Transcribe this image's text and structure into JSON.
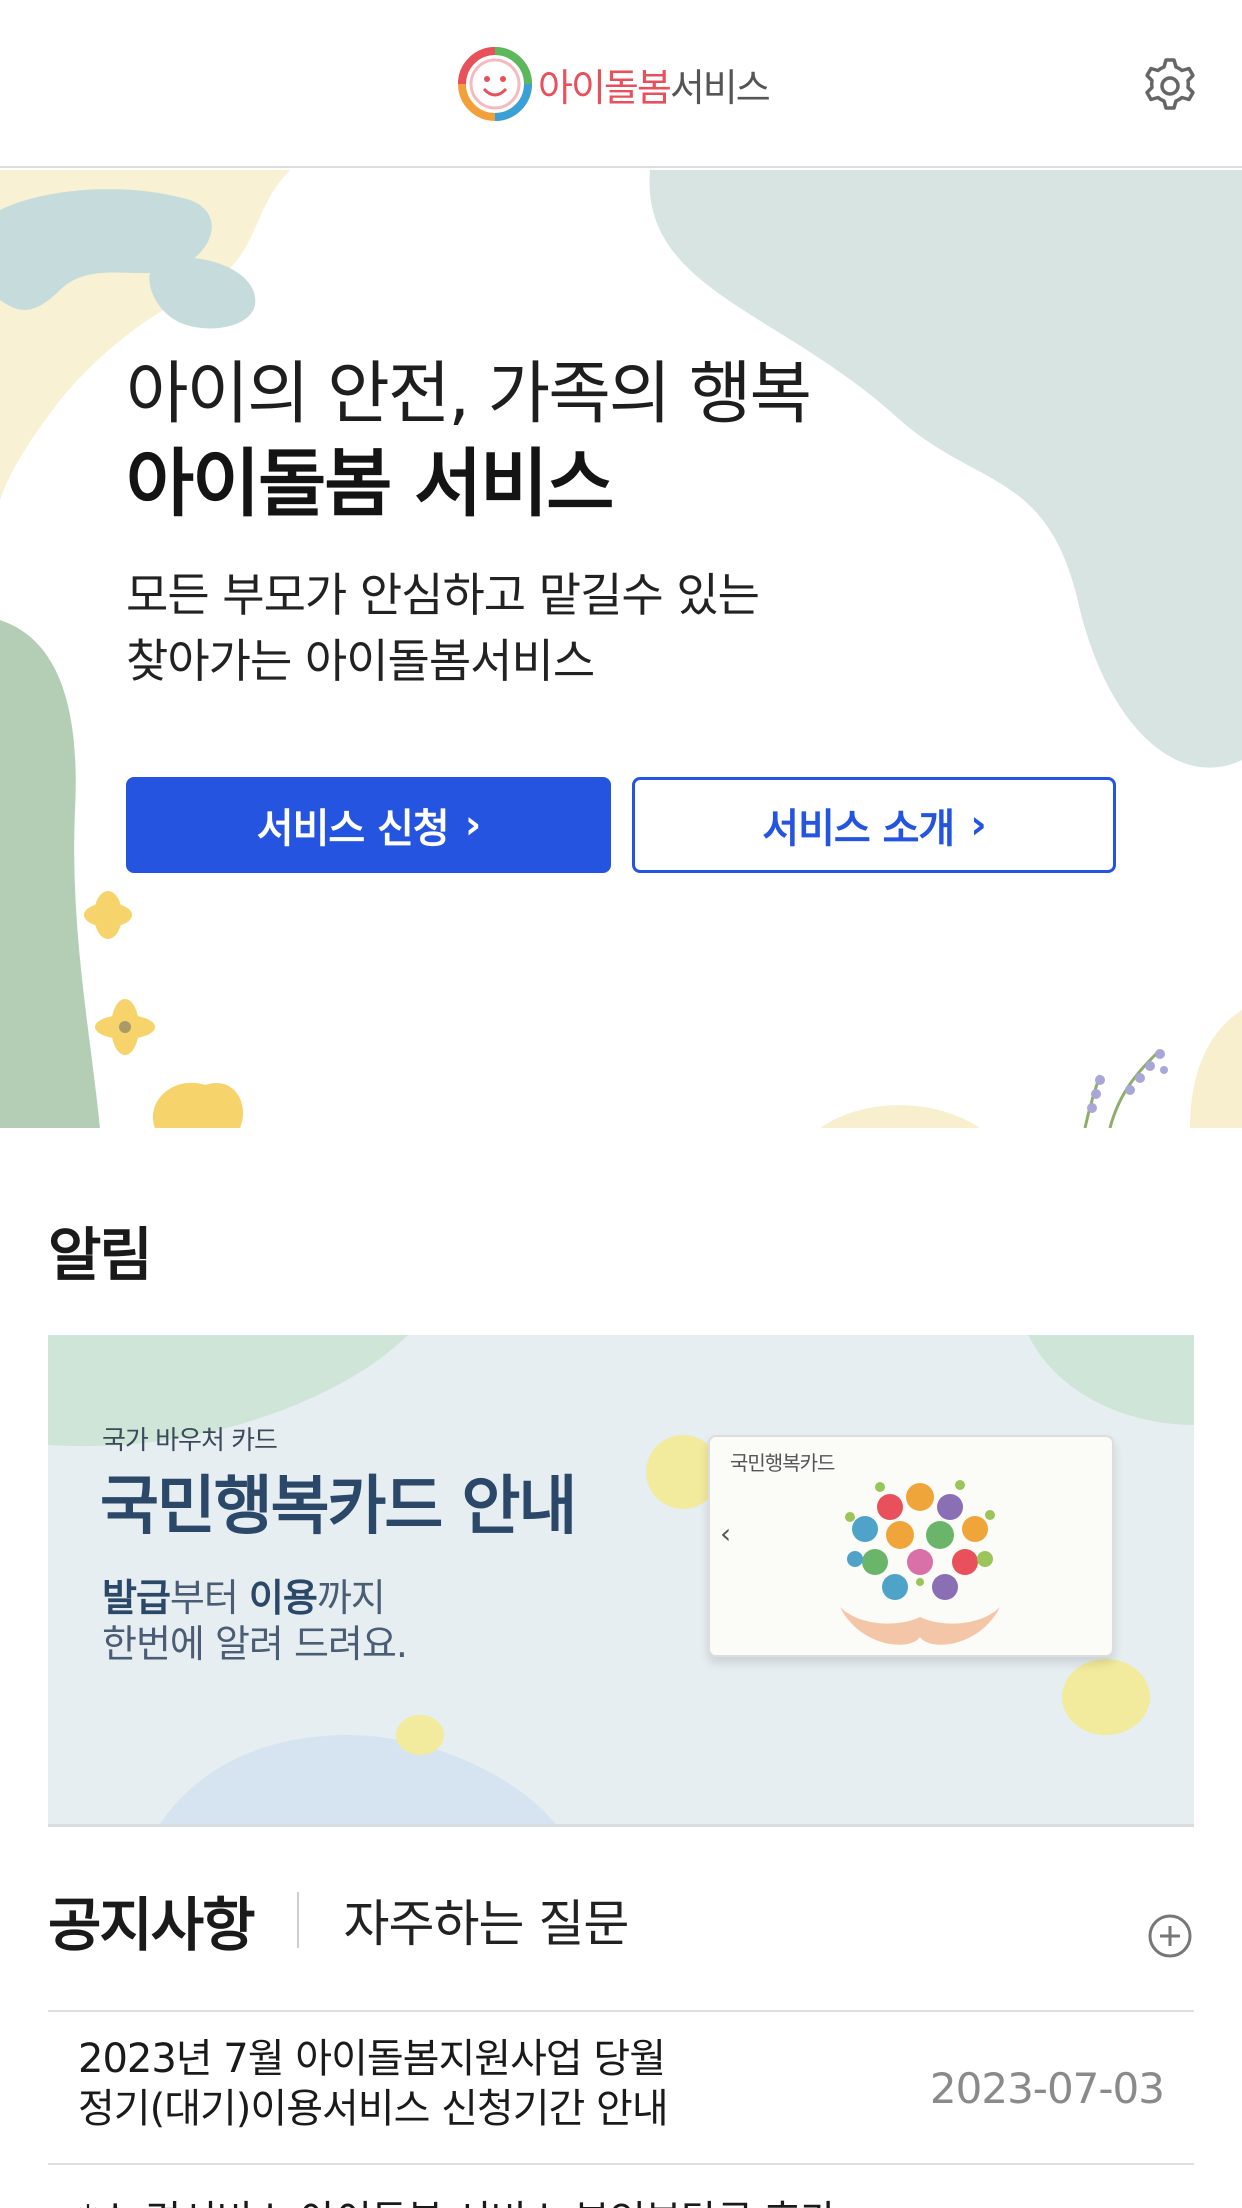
{
  "header": {
    "brand_text": "아이돌봄",
    "brand_suffix": "서비스"
  },
  "hero": {
    "title": "아이의 안전, 가족의 행복",
    "title_strong": "아이돌봄 서비스",
    "subtitle_line1": "모든 부모가 안심하고 맡길수 있는",
    "subtitle_line2": "찾아가는 아이돌봄서비스",
    "apply_button": "서비스 신청",
    "intro_button": "서비스 소개",
    "chevron": "›"
  },
  "notice_section": {
    "title": "알림"
  },
  "banner": {
    "eyebrow": "국가 바우처 카드",
    "title": "국민행복카드 안내",
    "desc_line1_strong1": "발급",
    "desc_line1_mid": "부터 ",
    "desc_line1_strong2": "이용",
    "desc_line1_end": "까지",
    "desc_line2": "한번에 알려 드려요.",
    "card_label": "국민행복카드",
    "card_arrow": "‹"
  },
  "tabs": {
    "active": "공지사항",
    "inactive": "자주하는 질문"
  },
  "notices": [
    {
      "title_line1": "2023년 7월 아이돌봄지원사업 당월",
      "title_line2": "정기(대기)이용서비스 신청기간 안내",
      "date": "2023-07-03"
    },
    {
      "title_line1": "*소 경서비스 아이돌봄 서비스 본인부담금 휴가"
    }
  ],
  "colors": {
    "primary": "#2454e0",
    "brand_red": "#e8505b",
    "banner_title": "#2c4868"
  },
  "icons": {
    "settings": "gear-icon",
    "more": "plus-circle-icon"
  }
}
